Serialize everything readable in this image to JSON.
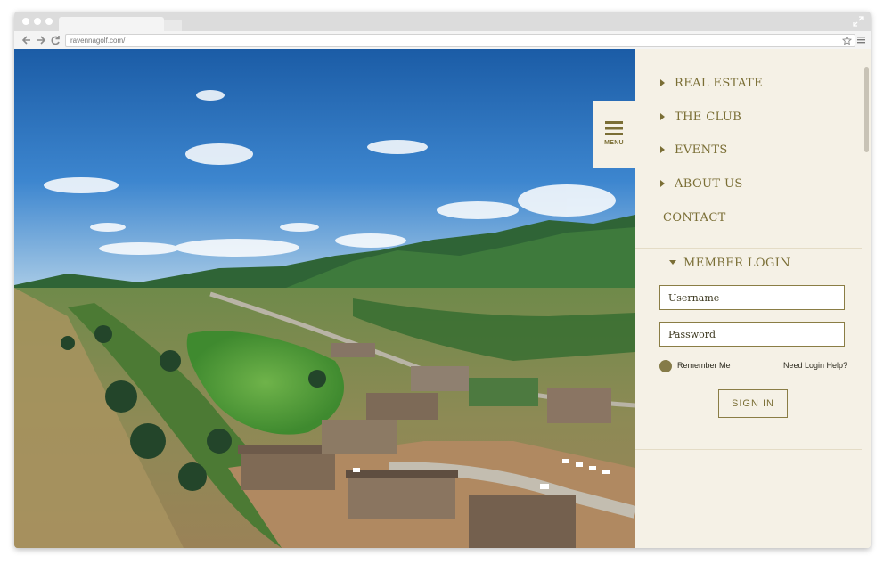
{
  "browser": {
    "url": "ravennagolf.com/",
    "window_dots": [
      "close",
      "minimize",
      "zoom"
    ],
    "nav_icons": [
      "back-arrow-icon",
      "forward-arrow-icon",
      "reload-icon"
    ],
    "bookmark_icon": "star-icon",
    "menu_icon": "hamburger-menu-icon",
    "fullscreen_icon": "expand-icon"
  },
  "hero": {
    "image_subject": "aerial view of golf course community with houses under construction, green hills, blue sky"
  },
  "menu_toggle": {
    "label": "MENU",
    "icon": "hamburger-icon"
  },
  "nav": {
    "items": [
      {
        "label": "REAL ESTATE",
        "has_arrow": true
      },
      {
        "label": "THE CLUB",
        "has_arrow": true
      },
      {
        "label": "EVENTS",
        "has_arrow": true
      },
      {
        "label": "ABOUT US",
        "has_arrow": true
      },
      {
        "label": "CONTACT",
        "has_arrow": false
      }
    ]
  },
  "login": {
    "title": "MEMBER LOGIN",
    "username_placeholder": "Username",
    "password_placeholder": "Password",
    "remember_label": "Remember Me",
    "help_link": "Need Login Help?",
    "signin_label": "SIGN IN"
  },
  "colors": {
    "accent": "#7a6e35",
    "panel_bg": "#f5f1e6",
    "field_border": "#8a7d45"
  }
}
